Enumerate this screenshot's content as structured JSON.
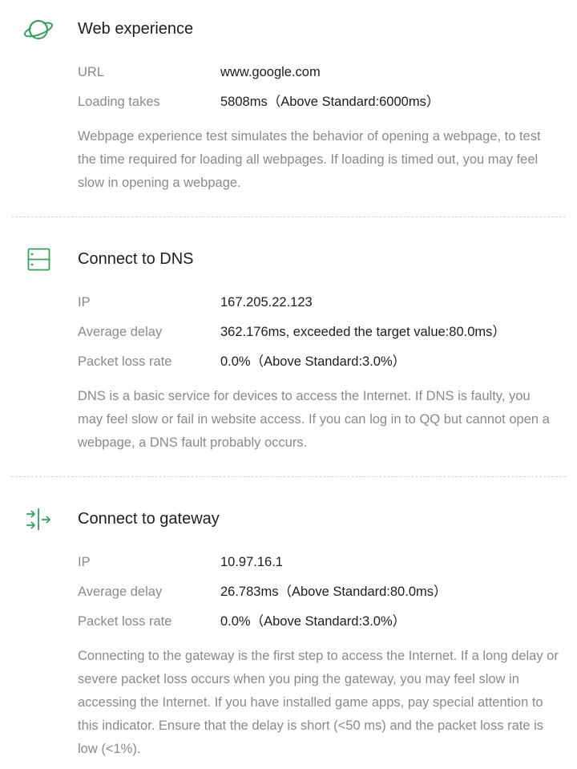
{
  "colors": {
    "accent": "#2fa35a",
    "label": "#8a8a8a",
    "value": "#1e1e1e",
    "divider": "#d6d6d6"
  },
  "sections": [
    {
      "icon": "planet-icon",
      "title": "Web experience",
      "rows": [
        {
          "label": "URL",
          "value": "www.google.com"
        },
        {
          "label": "Loading takes",
          "value": "5808ms（Above Standard:6000ms）"
        }
      ],
      "description": "Webpage experience test simulates the behavior of opening a webpage, to test the time required for loading all webpages. If loading is timed out, you may feel slow in opening a webpage."
    },
    {
      "icon": "server-icon",
      "title": "Connect to DNS",
      "rows": [
        {
          "label": "IP",
          "value": "167.205.22.123"
        },
        {
          "label": "Average delay",
          "value": "362.176ms, exceeded the target value:80.0ms）"
        },
        {
          "label": "Packet loss rate",
          "value": "0.0%（Above Standard:3.0%）"
        }
      ],
      "description": "DNS is a basic service for devices to access the Internet. If DNS is faulty, you may feel slow or fail in website access. If you can log in to QQ but cannot open a webpage, a DNS fault probably occurs."
    },
    {
      "icon": "gateway-icon",
      "title": "Connect to gateway",
      "rows": [
        {
          "label": "IP",
          "value": "10.97.16.1"
        },
        {
          "label": "Average delay",
          "value": "26.783ms（Above Standard:80.0ms）"
        },
        {
          "label": "Packet loss rate",
          "value": "0.0%（Above Standard:3.0%）"
        }
      ],
      "description": "Connecting to the gateway is the first step to access the Internet. If a long delay or severe packet loss occurs when you ping the gateway, you may feel slow in accessing the Internet. If you have installed game apps, pay special attention to this indicator. Ensure that the delay is short (<50 ms) and the packet loss rate is low (<1%)."
    }
  ]
}
